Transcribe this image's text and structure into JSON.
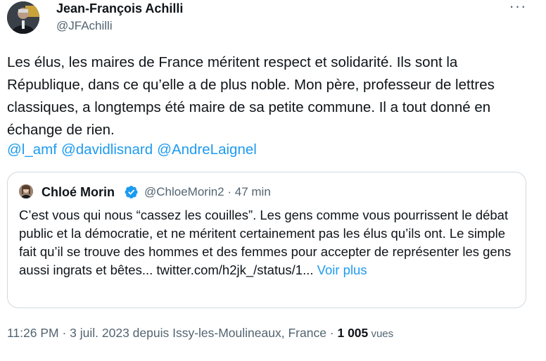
{
  "author": {
    "name": "Jean-François Achilli",
    "handle": "@JFAchilli"
  },
  "menu": {
    "more_label": "···"
  },
  "tweet": {
    "text": "Les élus, les maires de France méritent respect et solidarité. Ils sont la République, dans ce qu’elle a de plus noble. Mon père, professeur de lettres classiques, a longtemps été maire de sa petite commune. Il a tout donné en échange de rien.",
    "mentions": [
      "@l_amf",
      "@davidlisnard",
      "@AndreLaignel"
    ]
  },
  "quote": {
    "name": "Chloé Morin",
    "handle_time": "@ChloeMorin2 · 47 min",
    "text": "C’est vous qui nous “cassez les couilles”. Les gens comme vous pourrissent le débat public et la démocratie, et ne méritent certainement pas les élus qu’ils ont. Le simple fait qu’il se trouve des hommes et des femmes pour accepter de représenter les gens aussi ingrats et bêtes... twitter.com/h2jk_/status/1...",
    "more_label": "Voir plus"
  },
  "meta": {
    "timestamp": "11:26 PM · 3 juil. 2023 depuis Issy-les-Moulineaux, France · ",
    "view_count": "1 005",
    "view_label": " vues"
  },
  "colors": {
    "accent": "#1d9bf0",
    "secondary_text": "#536471",
    "border": "#cfd9de"
  }
}
